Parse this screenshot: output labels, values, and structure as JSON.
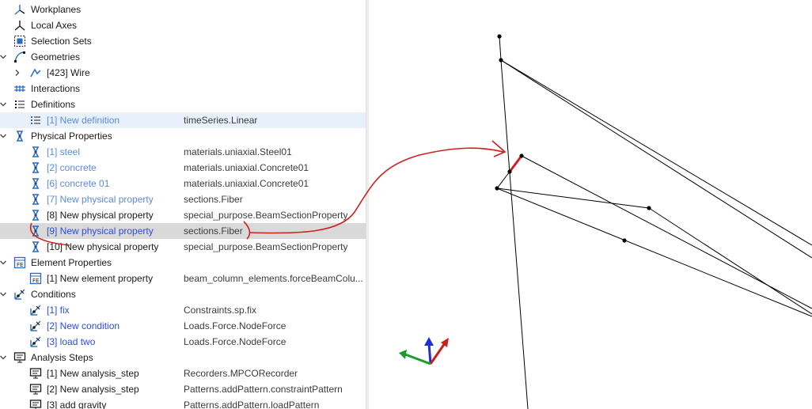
{
  "tree": [
    {
      "id": "workplanes",
      "label": "Workplanes",
      "type": "",
      "icon": "workplanes-icon",
      "chevron": "none",
      "color": "dark",
      "selected": "",
      "indent": 0
    },
    {
      "id": "local-axes",
      "label": "Local Axes",
      "type": "",
      "icon": "local-axes-icon",
      "chevron": "none",
      "color": "dark",
      "selected": "",
      "indent": 0
    },
    {
      "id": "selection-sets",
      "label": "Selection Sets",
      "type": "",
      "icon": "selection-sets-icon",
      "chevron": "none",
      "color": "dark",
      "selected": "",
      "indent": 0
    },
    {
      "id": "geometries",
      "label": "Geometries",
      "type": "",
      "icon": "geometries-icon",
      "chevron": "down",
      "color": "dark",
      "selected": "",
      "indent": 0
    },
    {
      "id": "wire-423",
      "label": "[423] Wire",
      "type": "",
      "icon": "wire-icon",
      "chevron": "right",
      "color": "dark",
      "selected": "",
      "indent": 1
    },
    {
      "id": "interactions",
      "label": "Interactions",
      "type": "",
      "icon": "interactions-icon",
      "chevron": "none",
      "color": "dark",
      "selected": "",
      "indent": 0
    },
    {
      "id": "definitions",
      "label": "Definitions",
      "type": "",
      "icon": "definitions-icon",
      "chevron": "down",
      "color": "dark",
      "selected": "",
      "indent": 0
    },
    {
      "id": "definition-1",
      "label": "[1] New definition",
      "type": "timeSeries.Linear",
      "icon": "definition-item-icon",
      "chevron": "none",
      "color": "lightblue",
      "selected": "light",
      "indent": 1
    },
    {
      "id": "physical-properties",
      "label": "Physical Properties",
      "type": "",
      "icon": "physical-property-icon",
      "chevron": "down",
      "color": "dark",
      "selected": "",
      "indent": 0
    },
    {
      "id": "pp-1",
      "label": "[1] steel",
      "type": "materials.uniaxial.Steel01",
      "icon": "physical-property-icon",
      "chevron": "none",
      "color": "lightblue",
      "selected": "",
      "indent": 1
    },
    {
      "id": "pp-2",
      "label": "[2] concrete",
      "type": "materials.uniaxial.Concrete01",
      "icon": "physical-property-icon",
      "chevron": "none",
      "color": "lightblue",
      "selected": "",
      "indent": 1
    },
    {
      "id": "pp-6",
      "label": "[6] concrete 01",
      "type": "materials.uniaxial.Concrete01",
      "icon": "physical-property-icon",
      "chevron": "none",
      "color": "lightblue",
      "selected": "",
      "indent": 1
    },
    {
      "id": "pp-7",
      "label": "[7] New physical property",
      "type": "sections.Fiber",
      "icon": "physical-property-icon",
      "chevron": "none",
      "color": "lightblue",
      "selected": "",
      "indent": 1
    },
    {
      "id": "pp-8",
      "label": "[8] New physical property",
      "type": "special_purpose.BeamSectionProperty",
      "icon": "physical-property-icon",
      "chevron": "none",
      "color": "dark",
      "selected": "",
      "indent": 1
    },
    {
      "id": "pp-9",
      "label": "[9] New physical property",
      "type": "sections.Fiber",
      "icon": "physical-property-icon",
      "chevron": "none",
      "color": "blue",
      "selected": "gray",
      "indent": 1
    },
    {
      "id": "pp-10",
      "label": "[10] New physical property",
      "type": "special_purpose.BeamSectionProperty",
      "icon": "physical-property-icon",
      "chevron": "none",
      "color": "dark",
      "selected": "",
      "indent": 1
    },
    {
      "id": "element-properties",
      "label": "Element Properties",
      "type": "",
      "icon": "element-property-icon",
      "chevron": "down",
      "color": "dark",
      "selected": "",
      "indent": 0
    },
    {
      "id": "ep-1",
      "label": "[1] New element property",
      "type": "beam_column_elements.forceBeamColu...",
      "icon": "element-property-icon",
      "chevron": "none",
      "color": "dark",
      "selected": "",
      "indent": 1
    },
    {
      "id": "conditions",
      "label": "Conditions",
      "type": "",
      "icon": "condition-icon",
      "chevron": "down",
      "color": "dark",
      "selected": "",
      "indent": 0
    },
    {
      "id": "cond-1",
      "label": "[1] fix",
      "type": "Constraints.sp.fix",
      "icon": "condition-icon",
      "chevron": "none",
      "color": "blue",
      "selected": "",
      "indent": 1
    },
    {
      "id": "cond-2",
      "label": "[2] New condition",
      "type": "Loads.Force.NodeForce",
      "icon": "condition-icon",
      "chevron": "none",
      "color": "blue",
      "selected": "",
      "indent": 1
    },
    {
      "id": "cond-3",
      "label": "[3] load two",
      "type": "Loads.Force.NodeForce",
      "icon": "condition-icon",
      "chevron": "none",
      "color": "blue",
      "selected": "",
      "indent": 1
    },
    {
      "id": "analysis-steps",
      "label": "Analysis Steps",
      "type": "",
      "icon": "analysis-step-icon",
      "chevron": "down",
      "color": "dark",
      "selected": "",
      "indent": 0
    },
    {
      "id": "as-1",
      "label": "[1] New analysis_step",
      "type": "Recorders.MPCORecorder",
      "icon": "analysis-step-icon",
      "chevron": "none",
      "color": "dark",
      "selected": "",
      "indent": 1
    },
    {
      "id": "as-2",
      "label": "[2] New analysis_step",
      "type": "Patterns.addPattern.constraintPattern",
      "icon": "analysis-step-icon",
      "chevron": "none",
      "color": "dark",
      "selected": "",
      "indent": 1
    },
    {
      "id": "as-3",
      "label": "[3] add gravity",
      "type": "Patterns.addPattern.loadPattern",
      "icon": "analysis-step-icon",
      "chevron": "none",
      "color": "dark",
      "selected": "",
      "indent": 1
    }
  ],
  "colors": {
    "dark": "#1a1a1a",
    "lightblue": "#5a8cd6",
    "blue": "#2a4fd6",
    "icon_blue": "#2b6bbf",
    "selection_light": "#e8f1fb",
    "selection_gray": "#d9d9d9",
    "annotation_red": "#d11f1f",
    "axis_x": "#c81e1e",
    "axis_y": "#1f9a2e",
    "axis_z": "#1f2fd6"
  }
}
